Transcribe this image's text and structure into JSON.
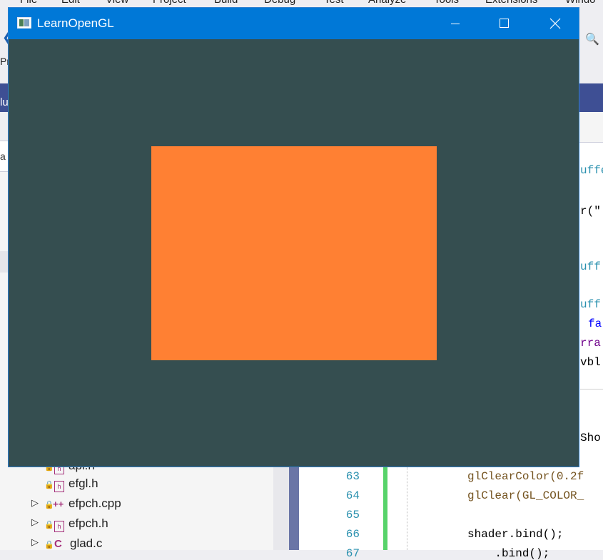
{
  "ide": {
    "menu": [
      "File",
      "Edit",
      "View",
      "Project",
      "Build",
      "Debug",
      "Test",
      "Analyze",
      "Tools",
      "Extensions",
      "Windo"
    ],
    "row2_fragment": "Pr",
    "title_strip_fragment": "lu",
    "search_fragment": "a",
    "solution_items": [
      {
        "name": "api.h",
        "icon": "header-file-icon",
        "expandable": false
      },
      {
        "name": "efgl.h",
        "icon": "header-file-icon",
        "expandable": false
      },
      {
        "name": "efpch.cpp",
        "icon": "cpp-file-icon",
        "expandable": true
      },
      {
        "name": "efpch.h",
        "icon": "header-file-icon",
        "expandable": true
      },
      {
        "name": "glad.c",
        "icon": "c-file-icon",
        "expandable": true
      }
    ],
    "code_fragments": [
      "uffe",
      "r(\"",
      "uff",
      "uff",
      "fa",
      "rra",
      "vbl",
      "Sho"
    ],
    "code_lines": [
      {
        "number": "63",
        "text": "glClearColor(0.2f"
      },
      {
        "number": "64",
        "text": "glClear(GL_COLOR_"
      },
      {
        "number": "65",
        "text": ""
      },
      {
        "number": "66",
        "text": "shader.bind();"
      },
      {
        "number": "67",
        "text": "    .bind();"
      }
    ]
  },
  "window": {
    "title": "LearnOpenGL",
    "icon": "app-window-icon",
    "controls": {
      "minimize": "minimize-icon",
      "maximize": "maximize-icon",
      "close": "close-icon"
    },
    "clear_color": "#354e50",
    "quad_color": "#ff8033"
  }
}
